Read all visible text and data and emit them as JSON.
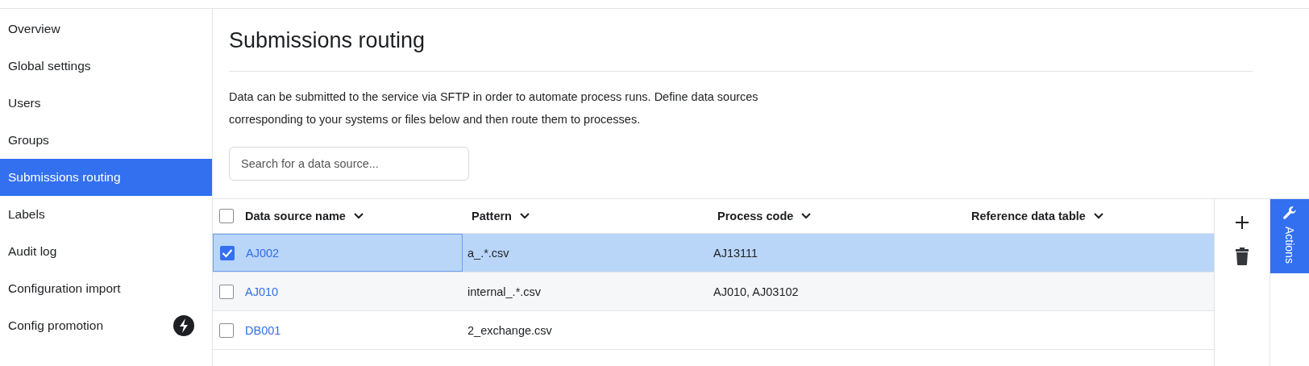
{
  "sidebar": {
    "items": [
      {
        "label": "Overview",
        "selected": false
      },
      {
        "label": "Global settings",
        "selected": false
      },
      {
        "label": "Users",
        "selected": false
      },
      {
        "label": "Groups",
        "selected": false
      },
      {
        "label": "Submissions routing",
        "selected": true
      },
      {
        "label": "Labels",
        "selected": false
      },
      {
        "label": "Audit log",
        "selected": false
      },
      {
        "label": "Configuration import",
        "selected": false
      },
      {
        "label": "Config promotion",
        "selected": false,
        "has_badge": true
      }
    ]
  },
  "page": {
    "title": "Submissions routing",
    "description": "Data can be submitted to the service via SFTP in order to automate process runs. Define data sources corresponding to your systems or files below and then route them to processes."
  },
  "search": {
    "placeholder": "Search for a data source..."
  },
  "table": {
    "select_all": {
      "checked": false
    },
    "columns": [
      "Data source name",
      "Pattern",
      "Process code",
      "Reference data table"
    ],
    "rows": [
      {
        "name": "AJ002",
        "pattern": "a_.*.csv",
        "process_code": "AJ13111",
        "checked": true,
        "selected": true
      },
      {
        "name": "AJ010",
        "pattern": "internal_.*.csv",
        "process_code": "AJ010, AJ03102",
        "checked": false,
        "selected": false
      },
      {
        "name": "DB001",
        "pattern": "2_exchange.csv",
        "checked": false,
        "selected": false
      }
    ]
  },
  "actions_tab": {
    "label": "Actions"
  }
}
